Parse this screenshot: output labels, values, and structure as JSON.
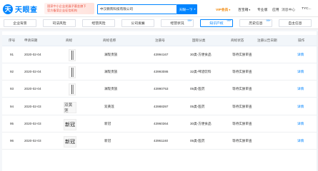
{
  "brand": {
    "logo_text": "天眼查",
    "logo_mark": "天"
  },
  "promo": {
    "line1": "国家中小企业发展子基金旗下",
    "line2": "官方备案企业征信机构"
  },
  "search": {
    "value": "中汉教育科技有限公司",
    "button": "天眼一下",
    "caret": "▾"
  },
  "nav": {
    "vip": "VIP会员",
    "vip_caret": "▾",
    "b1": "百宝箱",
    "b1_caret": "▾",
    "b2": "专业版",
    "b3": "应用",
    "b4": "消息中心",
    "user": "TYC..."
  },
  "tabs": [
    {
      "label": "企业背景",
      "count": ""
    },
    {
      "label": "司法风险",
      "count": ""
    },
    {
      "label": "经营风险",
      "count": ""
    },
    {
      "label": "公司发展",
      "count": ""
    },
    {
      "label": "经营状况",
      "count": "99+"
    },
    {
      "label": "知识产权",
      "count": "99+"
    },
    {
      "label": "历史信息",
      "count": "99+"
    },
    {
      "label": "自主信息",
      "count": ""
    }
  ],
  "table": {
    "headers": {
      "seq": "序号",
      "date": "申请日期",
      "img": "商标",
      "name": "商标名称",
      "reg": "注册号",
      "cls": "国际分类",
      "status": "商标状态",
      "notice": "注册公告日期",
      "op": "操作"
    },
    "rows": [
      {
        "seq": "91",
        "date": "2020-02-04",
        "img": "line",
        "img_text": "",
        "name": "澜现贵族",
        "reg": "43994167",
        "cls": "30类-方便食品",
        "status": "等待实质审查",
        "op": "详情"
      },
      {
        "seq": "92",
        "date": "2020-02-04",
        "img": "line",
        "img_text": "",
        "name": "澜现贵族",
        "reg": "43993086",
        "cls": "32类-啤酒饮料",
        "status": "等待实质审查",
        "op": "详情"
      },
      {
        "seq": "93",
        "date": "2020-02-04",
        "img": "line",
        "img_text": "",
        "name": "澜现贵族",
        "reg": "43990753",
        "cls": "05类-医药",
        "status": "等待实质审查",
        "op": "详情"
      },
      {
        "seq": "94",
        "date": "2020-02-03",
        "img": "text",
        "img_text": "双黄莲",
        "name": "双黄莲",
        "reg": "43988397",
        "cls": "05类-医药",
        "status": "等待实质审查",
        "op": "详情"
      },
      {
        "seq": "95",
        "date": "2020-02-03",
        "img": "text",
        "img_text": "新冠",
        "name": "新冠",
        "reg": "43960364",
        "cls": "30类-方便食品",
        "status": "等待实质审查",
        "op": "详情"
      },
      {
        "seq": "96",
        "date": "2020-02-03",
        "img": "text",
        "img_text": "新冠",
        "name": "新冠",
        "reg": "43961160",
        "cls": "05类-医药",
        "status": "等待实质审查",
        "op": "详情"
      }
    ]
  }
}
